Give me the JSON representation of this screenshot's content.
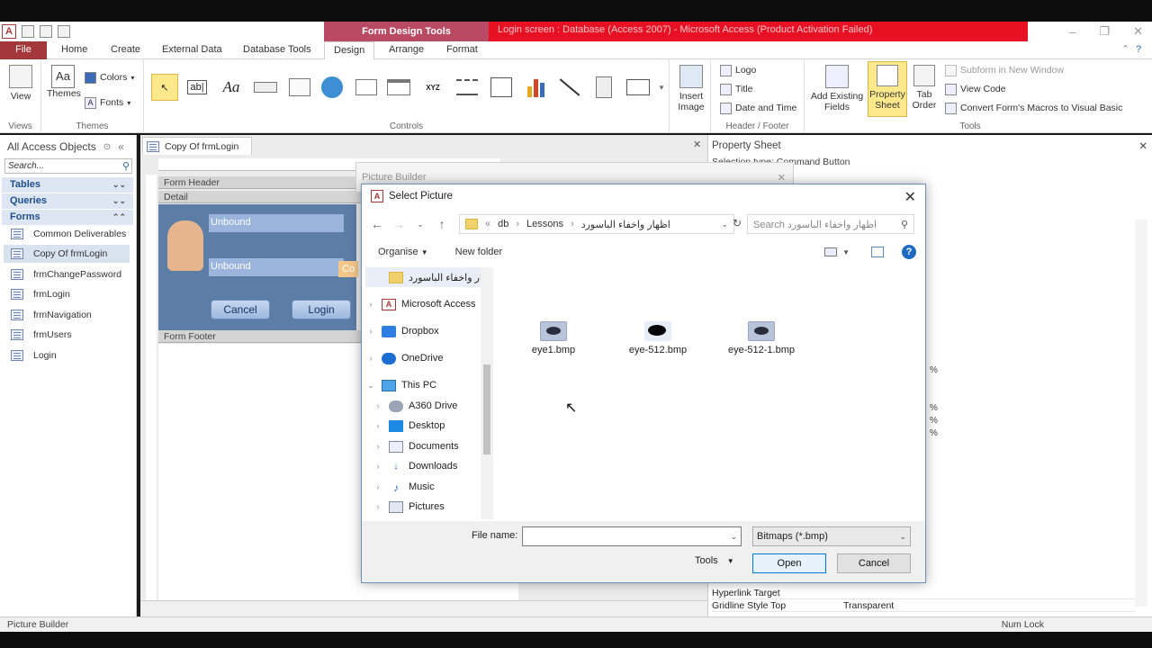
{
  "app": {
    "title": "Login screen : Database (Access 2007) - Microsoft Access (Product Activation Failed)",
    "context_tab": "Form Design Tools"
  },
  "tabs": [
    "File",
    "Home",
    "Create",
    "External Data",
    "Database Tools",
    "Design",
    "Arrange",
    "Format"
  ],
  "ribbon": {
    "views": {
      "view": "View",
      "group": "Views"
    },
    "themes": {
      "themes": "Themes",
      "colors": "Colors",
      "fonts": "Fonts",
      "group": "Themes"
    },
    "controls": {
      "group": "Controls",
      "insert_image": "Insert Image"
    },
    "header_footer": {
      "logo": "Logo",
      "title": "Title",
      "date_time": "Date and Time",
      "group": "Header / Footer"
    },
    "tools": {
      "add_fields": "Add Existing Fields",
      "property_sheet": "Property Sheet",
      "tab_order": "Tab Order",
      "subform": "Subform in New Window",
      "view_code": "View Code",
      "convert": "Convert Form's Macros to Visual Basic",
      "group": "Tools"
    }
  },
  "nav": {
    "header": "All Access Objects",
    "search": "Search...",
    "categories": [
      "Tables",
      "Queries",
      "Forms"
    ],
    "items": [
      "Common Deliverables",
      "Copy Of frmLogin",
      "frmChangePassword",
      "frmLogin",
      "frmNavigation",
      "frmUsers",
      "Login"
    ]
  },
  "document": {
    "tab": "Copy Of frmLogin",
    "form_header": "Form Header",
    "detail": "Detail",
    "form_footer": "Form Footer",
    "unbound": "Unbound",
    "cancel": "Cancel",
    "login": "Login",
    "partial": "Co"
  },
  "property_sheet": {
    "title": "Property Sheet",
    "selection": "Selection type: Command Button",
    "rows": [
      {
        "name": "Hyperlink Target",
        "value": ""
      },
      {
        "name": "Gridline Style Top",
        "value": "Transparent"
      }
    ],
    "pct": "%"
  },
  "picture_builder": {
    "title": "Picture Builder"
  },
  "dialog": {
    "title": "Select Picture",
    "path": [
      "db",
      "Lessons",
      "اظهار واخفاء الباسورد"
    ],
    "search_placeholder": "Search اظهار واخفاء الباسورد",
    "organise": "Organise",
    "new_folder": "New folder",
    "tree": [
      {
        "label": "ار واخفاء الباسورد"
      },
      {
        "label": "Microsoft Access"
      },
      {
        "label": "Dropbox"
      },
      {
        "label": "OneDrive"
      },
      {
        "label": "This PC"
      },
      {
        "label": "A360 Drive"
      },
      {
        "label": "Desktop"
      },
      {
        "label": "Documents"
      },
      {
        "label": "Downloads"
      },
      {
        "label": "Music"
      },
      {
        "label": "Pictures"
      }
    ],
    "files": [
      "eye1.bmp",
      "eye-512.bmp",
      "eye-512-1.bmp"
    ],
    "file_name_label": "File name:",
    "file_name_value": "",
    "filter": "Bitmaps (*.bmp)",
    "tools": "Tools",
    "open": "Open",
    "cancel": "Cancel"
  },
  "status": {
    "left": "Picture Builder",
    "num_lock": "Num Lock"
  }
}
